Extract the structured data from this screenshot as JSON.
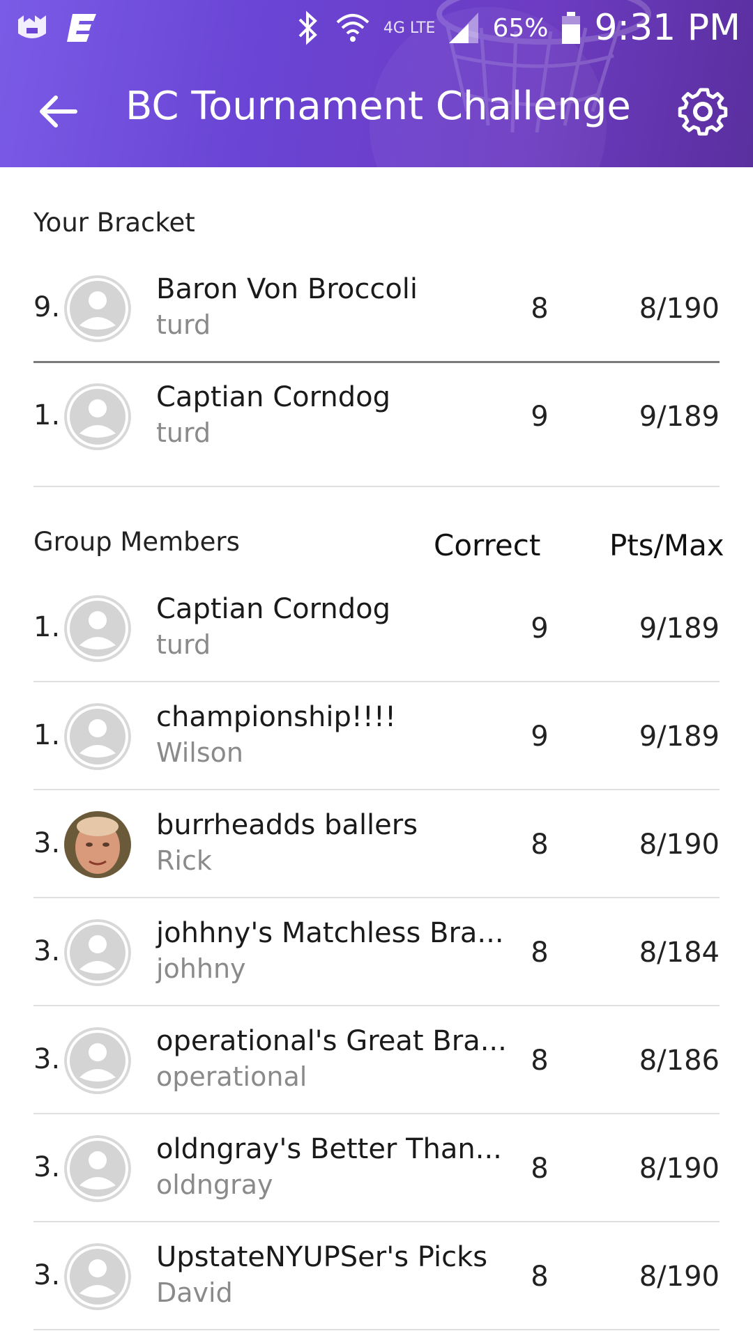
{
  "status_bar": {
    "battery": "65%",
    "time": "9:31 PM",
    "network": "4G LTE"
  },
  "app_bar": {
    "title": "BC Tournament Challenge",
    "back_icon": "arrow-back-icon",
    "settings_icon": "gear-icon",
    "background_color": "#6a44d4"
  },
  "your_bracket": {
    "label": "Your Bracket",
    "rows": [
      {
        "rank": "9.",
        "name": "Baron Von Broccoli",
        "owner": "turd",
        "correct": "8",
        "pts": "8/190",
        "avatar": "default"
      },
      {
        "rank": "1.",
        "name": "Captian Corndog",
        "owner": "turd",
        "correct": "9",
        "pts": "9/189",
        "avatar": "default"
      }
    ]
  },
  "group_members": {
    "label": "Group Members",
    "col_correct": "Correct",
    "col_pts": "Pts/Max",
    "rows": [
      {
        "rank": "1.",
        "name": "Captian Corndog",
        "owner": "turd",
        "correct": "9",
        "pts": "9/189",
        "avatar": "default"
      },
      {
        "rank": "1.",
        "name": "championship!!!!",
        "owner": "Wilson",
        "correct": "9",
        "pts": "9/189",
        "avatar": "default"
      },
      {
        "rank": "3.",
        "name": "burrheadds ballers",
        "owner": "Rick",
        "correct": "8",
        "pts": "8/190",
        "avatar": "photo"
      },
      {
        "rank": "3.",
        "name": "johhny's Matchless Bra...",
        "owner": "johhny",
        "correct": "8",
        "pts": "8/184",
        "avatar": "default"
      },
      {
        "rank": "3.",
        "name": "operational's Great Bra...",
        "owner": "operational",
        "correct": "8",
        "pts": "8/186",
        "avatar": "default"
      },
      {
        "rank": "3.",
        "name": "oldngray's Better Than...",
        "owner": "oldngray",
        "correct": "8",
        "pts": "8/190",
        "avatar": "default"
      },
      {
        "rank": "3.",
        "name": "UpstateNYUPSer's Picks",
        "owner": "David",
        "correct": "8",
        "pts": "8/190",
        "avatar": "default"
      }
    ]
  }
}
